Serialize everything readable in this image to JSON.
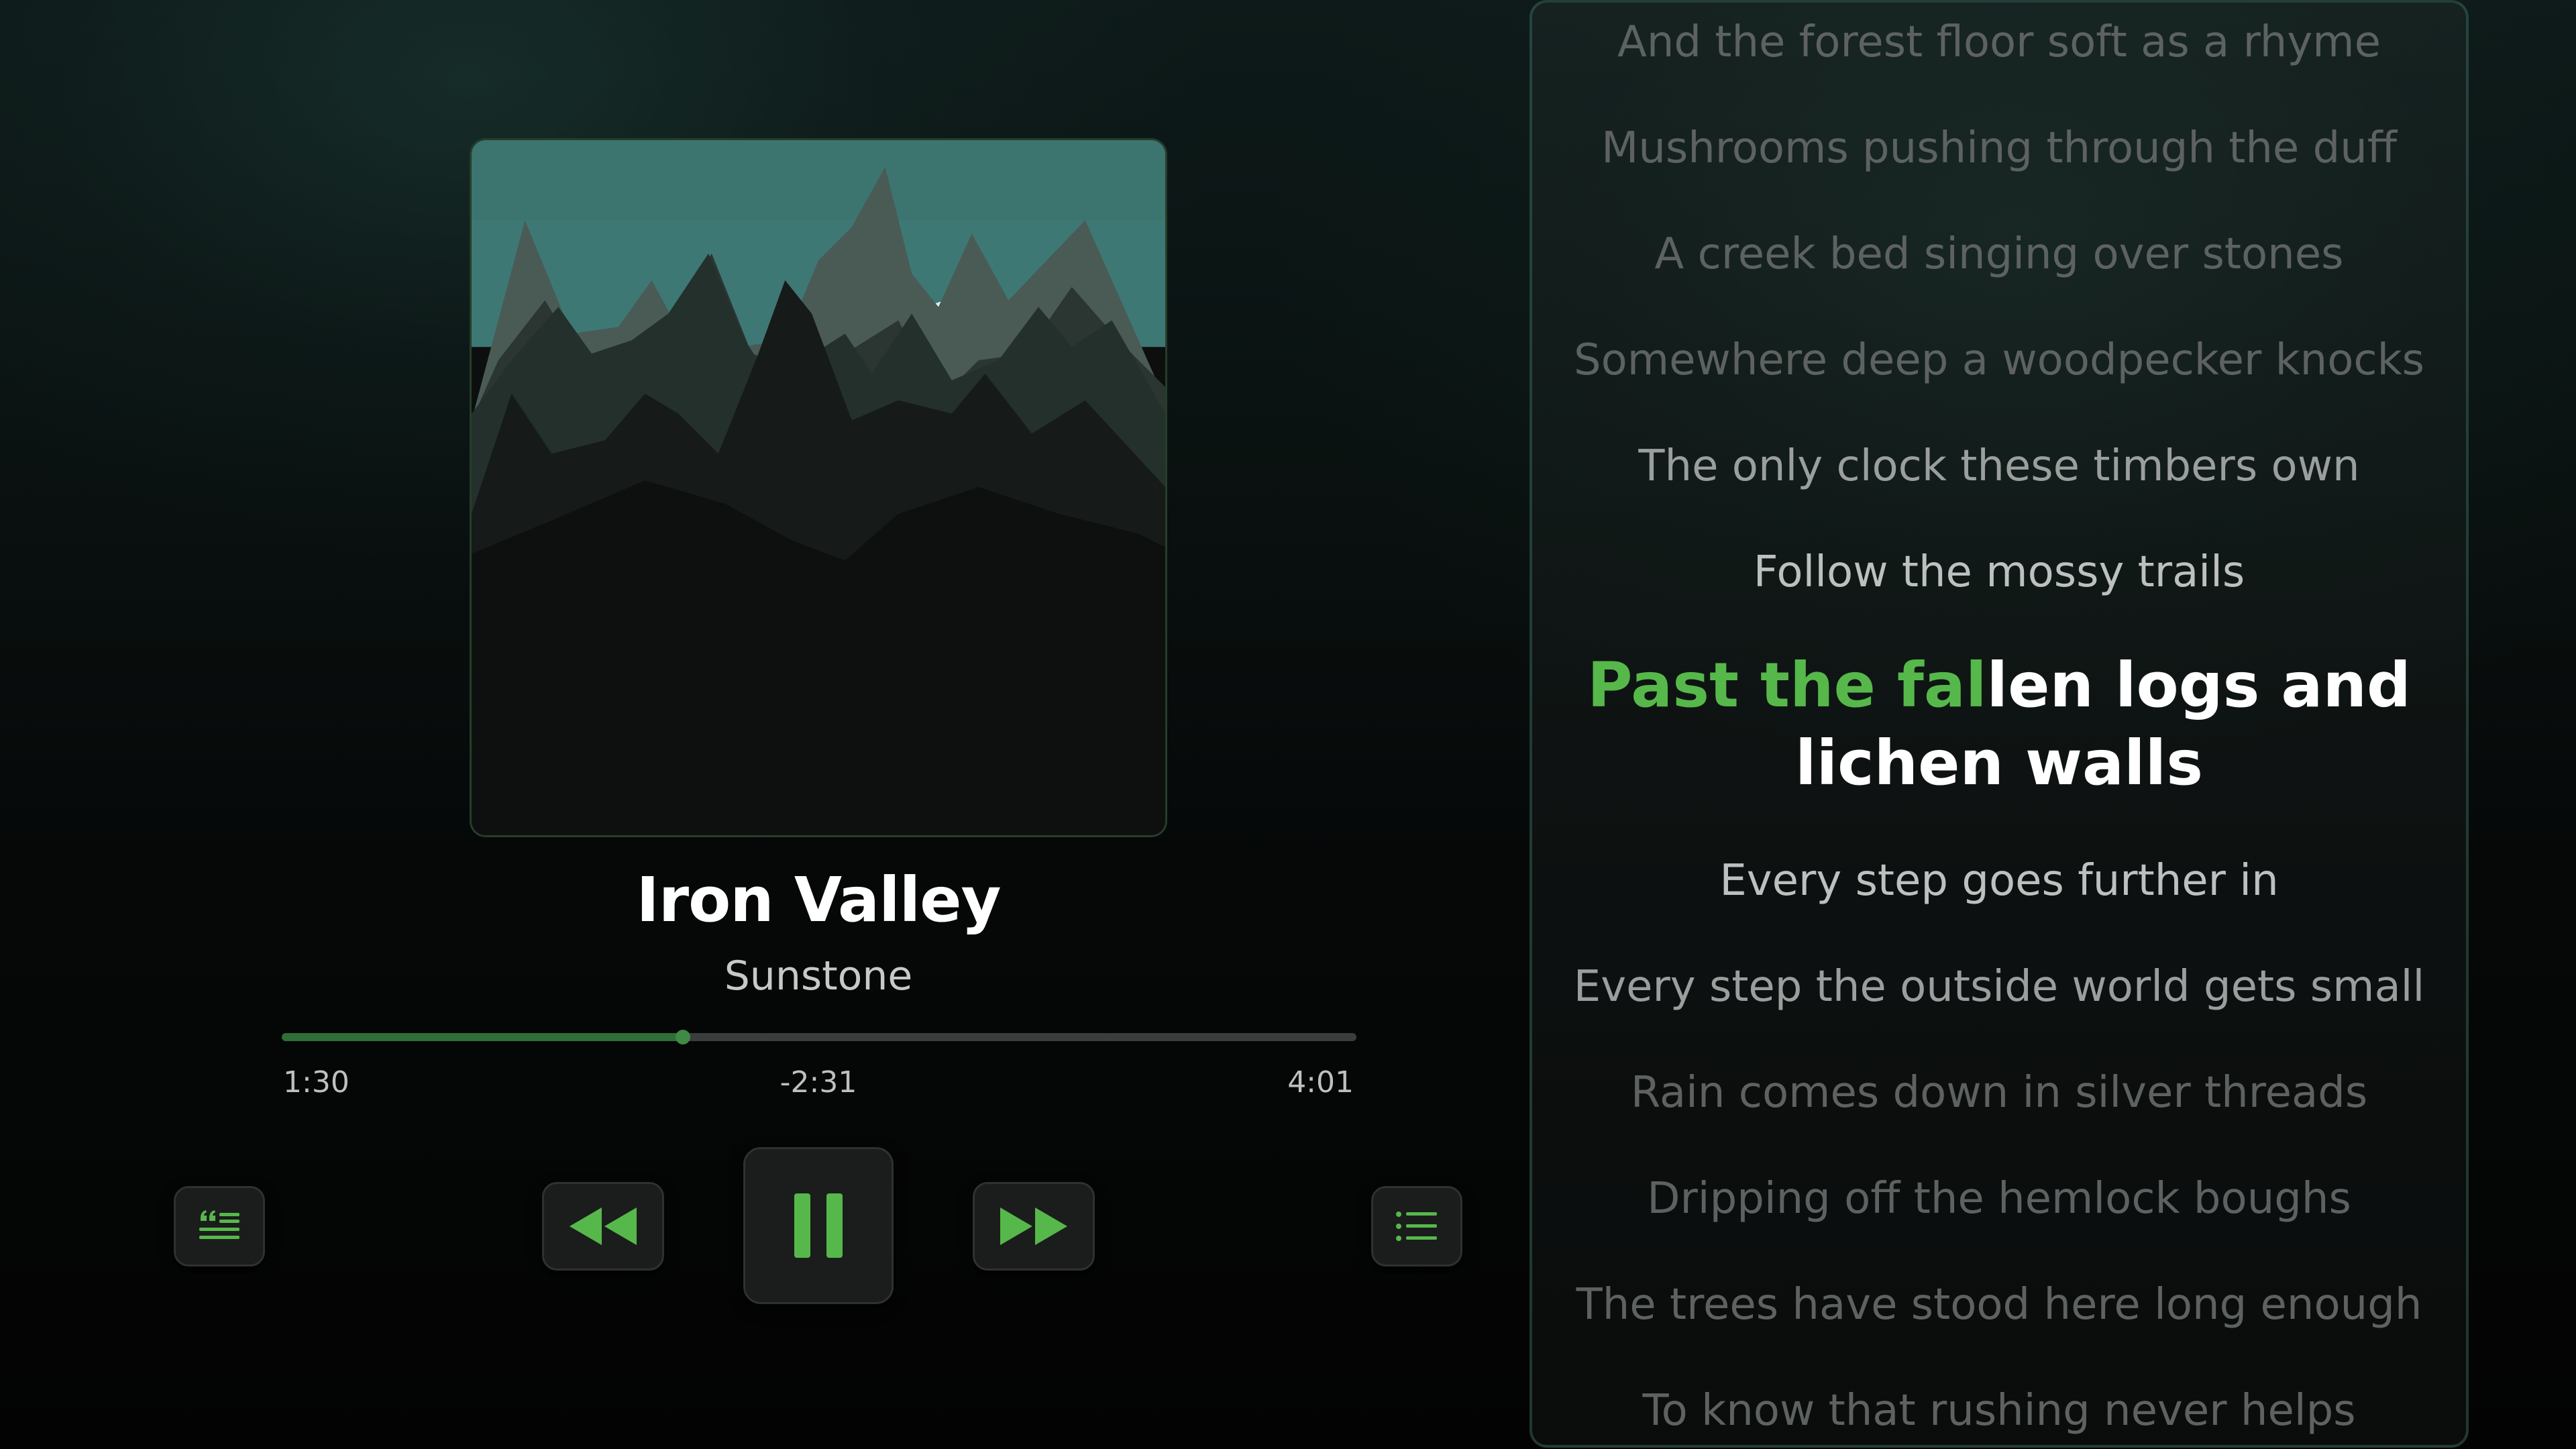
{
  "colors": {
    "accent": "#56b84a",
    "progress_fill": "#2f6e37",
    "control_bg": "#1b1d1c",
    "lyric_dim": "#5d6261",
    "lyric_current": "#ffffff"
  },
  "track": {
    "title": "Iron Valley",
    "artist": "Sunstone"
  },
  "playback": {
    "elapsed": "1:30",
    "remaining": "-2:31",
    "total": "4:01",
    "progress": 0.373
  },
  "controls": {
    "lyrics_icon": "lyrics-quote-icon",
    "prev_icon": "rewind-icon",
    "play_icon": "pause-icon",
    "next_icon": "fast-forward-icon",
    "queue_icon": "list-icon"
  },
  "lyrics": {
    "before": [
      "And the forest floor soft as a rhyme",
      "Mushrooms pushing through the duff",
      "A creek bed singing over stones",
      "Somewhere deep a woodpecker knocks",
      "The only clock these timbers own",
      "Follow the mossy trails"
    ],
    "current_sung": "Past the fal",
    "current_rest_line1": "len logs and",
    "current_line2": "lichen walls",
    "after": [
      "Every step goes further in",
      "Every step the outside world gets small",
      "Rain comes down in silver threads",
      "Dripping off the hemlock boughs",
      "The trees have stood here long enough",
      "To know that rushing never helps"
    ]
  }
}
